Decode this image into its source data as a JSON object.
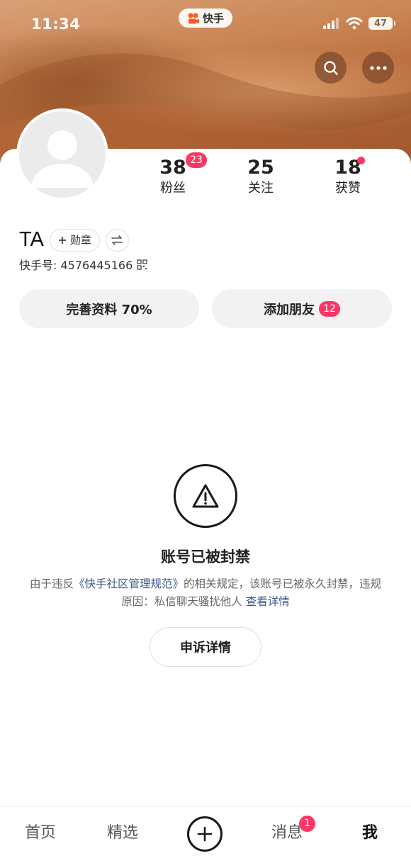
{
  "status_bar": {
    "time": "11:34",
    "app_name": "快手",
    "battery": "47"
  },
  "header": {
    "search_icon": "search-icon",
    "more_icon": "more-horizontal-icon"
  },
  "profile": {
    "stats": [
      {
        "value": "38",
        "label": "粉丝",
        "badge": "23"
      },
      {
        "value": "25",
        "label": "关注"
      },
      {
        "value": "18",
        "label": "获赞",
        "dot": true
      }
    ],
    "name": "TA",
    "medal_label": "勋章",
    "id_text": "快手号: 4576445166"
  },
  "actions": {
    "complete_profile": "完善资料 70%",
    "add_friend": "添加朋友",
    "add_friend_badge": "12"
  },
  "ban_notice": {
    "title": "账号已被封禁",
    "desc_prefix": "由于违反",
    "rule_link": "《快手社区管理规范》",
    "desc_middle": "的相关规定，该账号已被永久封禁，违规原因：私信聊天骚扰他人 ",
    "detail_link": "查看详情",
    "appeal_button": "申诉详情"
  },
  "bottom_nav": {
    "items": [
      "首页",
      "精选",
      "消息",
      "我"
    ],
    "message_badge": "1",
    "active": "我"
  },
  "colors": {
    "accent_badge": "#fe3666",
    "link": "#3c5a8a"
  }
}
